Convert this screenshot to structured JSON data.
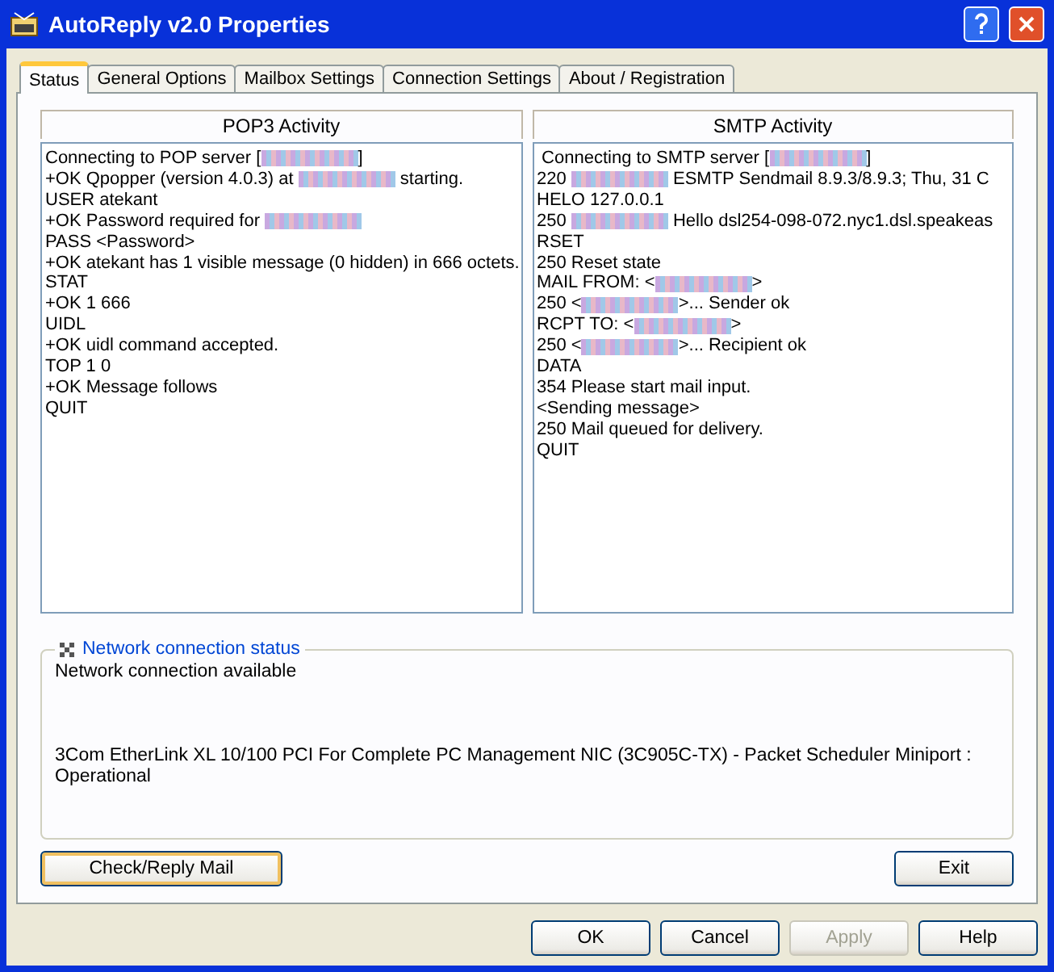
{
  "window": {
    "title": "AutoReply v2.0 Properties"
  },
  "tabs": [
    {
      "label": "Status",
      "selected": true
    },
    {
      "label": "General Options",
      "selected": false
    },
    {
      "label": "Mailbox Settings",
      "selected": false
    },
    {
      "label": "Connection Settings",
      "selected": false
    },
    {
      "label": "About / Registration",
      "selected": false
    }
  ],
  "panels": [
    {
      "title": "POP3 Activity",
      "lines": [
        [
          {
            "kind": "text",
            "text": "Connecting to POP server ["
          },
          {
            "kind": "redacted"
          },
          {
            "kind": "text",
            "text": "]"
          }
        ],
        [
          {
            "kind": "text",
            "text": "+OK Qpopper (version 4.0.3) at "
          },
          {
            "kind": "redacted"
          },
          {
            "kind": "text",
            "text": " starting."
          }
        ],
        [
          {
            "kind": "text",
            "text": "USER atekant"
          }
        ],
        [
          {
            "kind": "text",
            "text": "+OK Password required for "
          },
          {
            "kind": "redacted"
          }
        ],
        [
          {
            "kind": "text",
            "text": "PASS <Password>"
          }
        ],
        [
          {
            "kind": "text",
            "text": "+OK atekant has 1 visible message (0 hidden) in 666 octets."
          }
        ],
        [
          {
            "kind": "text",
            "text": "STAT"
          }
        ],
        [
          {
            "kind": "text",
            "text": "+OK 1 666"
          }
        ],
        [
          {
            "kind": "text",
            "text": "UIDL"
          }
        ],
        [
          {
            "kind": "text",
            "text": "+OK uidl command accepted."
          }
        ],
        [
          {
            "kind": "text",
            "text": "TOP 1 0"
          }
        ],
        [
          {
            "kind": "text",
            "text": "+OK Message follows"
          }
        ],
        [
          {
            "kind": "text",
            "text": "QUIT"
          }
        ]
      ]
    },
    {
      "title": "SMTP Activity",
      "lines": [
        [
          {
            "kind": "text",
            "text": " Connecting to SMTP server ["
          },
          {
            "kind": "redacted"
          },
          {
            "kind": "text",
            "text": "]"
          }
        ],
        [
          {
            "kind": "text",
            "text": "220 "
          },
          {
            "kind": "redacted"
          },
          {
            "kind": "text",
            "text": " ESMTP Sendmail 8.9.3/8.9.3; Thu, 31 C"
          }
        ],
        [
          {
            "kind": "text",
            "text": "HELO 127.0.0.1"
          }
        ],
        [
          {
            "kind": "text",
            "text": "250 "
          },
          {
            "kind": "redacted"
          },
          {
            "kind": "text",
            "text": " Hello dsl254-098-072.nyc1.dsl.speakeas"
          }
        ],
        [
          {
            "kind": "text",
            "text": "RSET"
          }
        ],
        [
          {
            "kind": "text",
            "text": "250 Reset state"
          }
        ],
        [
          {
            "kind": "text",
            "text": "MAIL FROM: <"
          },
          {
            "kind": "redacted"
          },
          {
            "kind": "text",
            "text": ">"
          }
        ],
        [
          {
            "kind": "text",
            "text": "250 <"
          },
          {
            "kind": "redacted"
          },
          {
            "kind": "text",
            "text": ">... Sender ok"
          }
        ],
        [
          {
            "kind": "text",
            "text": "RCPT TO: <"
          },
          {
            "kind": "redacted"
          },
          {
            "kind": "text",
            "text": ">"
          }
        ],
        [
          {
            "kind": "text",
            "text": "250 <"
          },
          {
            "kind": "redacted"
          },
          {
            "kind": "text",
            "text": ">... Recipient ok"
          }
        ],
        [
          {
            "kind": "text",
            "text": "DATA"
          }
        ],
        [
          {
            "kind": "text",
            "text": "354 Please start mail input."
          }
        ],
        [
          {
            "kind": "text",
            "text": "<Sending message>"
          }
        ],
        [
          {
            "kind": "text",
            "text": "250 Mail queued for delivery."
          }
        ],
        [
          {
            "kind": "text",
            "text": "QUIT"
          }
        ]
      ]
    }
  ],
  "network": {
    "title": "Network connection status",
    "status": "Network connection available",
    "adapter": "3Com EtherLink XL 10/100 PCI For Complete PC Management NIC (3C905C-TX) - Packet Scheduler Miniport : Operational"
  },
  "actions": [
    {
      "label": "Check/Reply Mail",
      "focused": true
    },
    {
      "label": "Exit",
      "focused": false
    }
  ],
  "dialog_buttons": [
    {
      "label": "OK",
      "disabled": false
    },
    {
      "label": "Cancel",
      "disabled": false
    },
    {
      "label": "Apply",
      "disabled": true
    },
    {
      "label": "Help",
      "disabled": false
    }
  ]
}
